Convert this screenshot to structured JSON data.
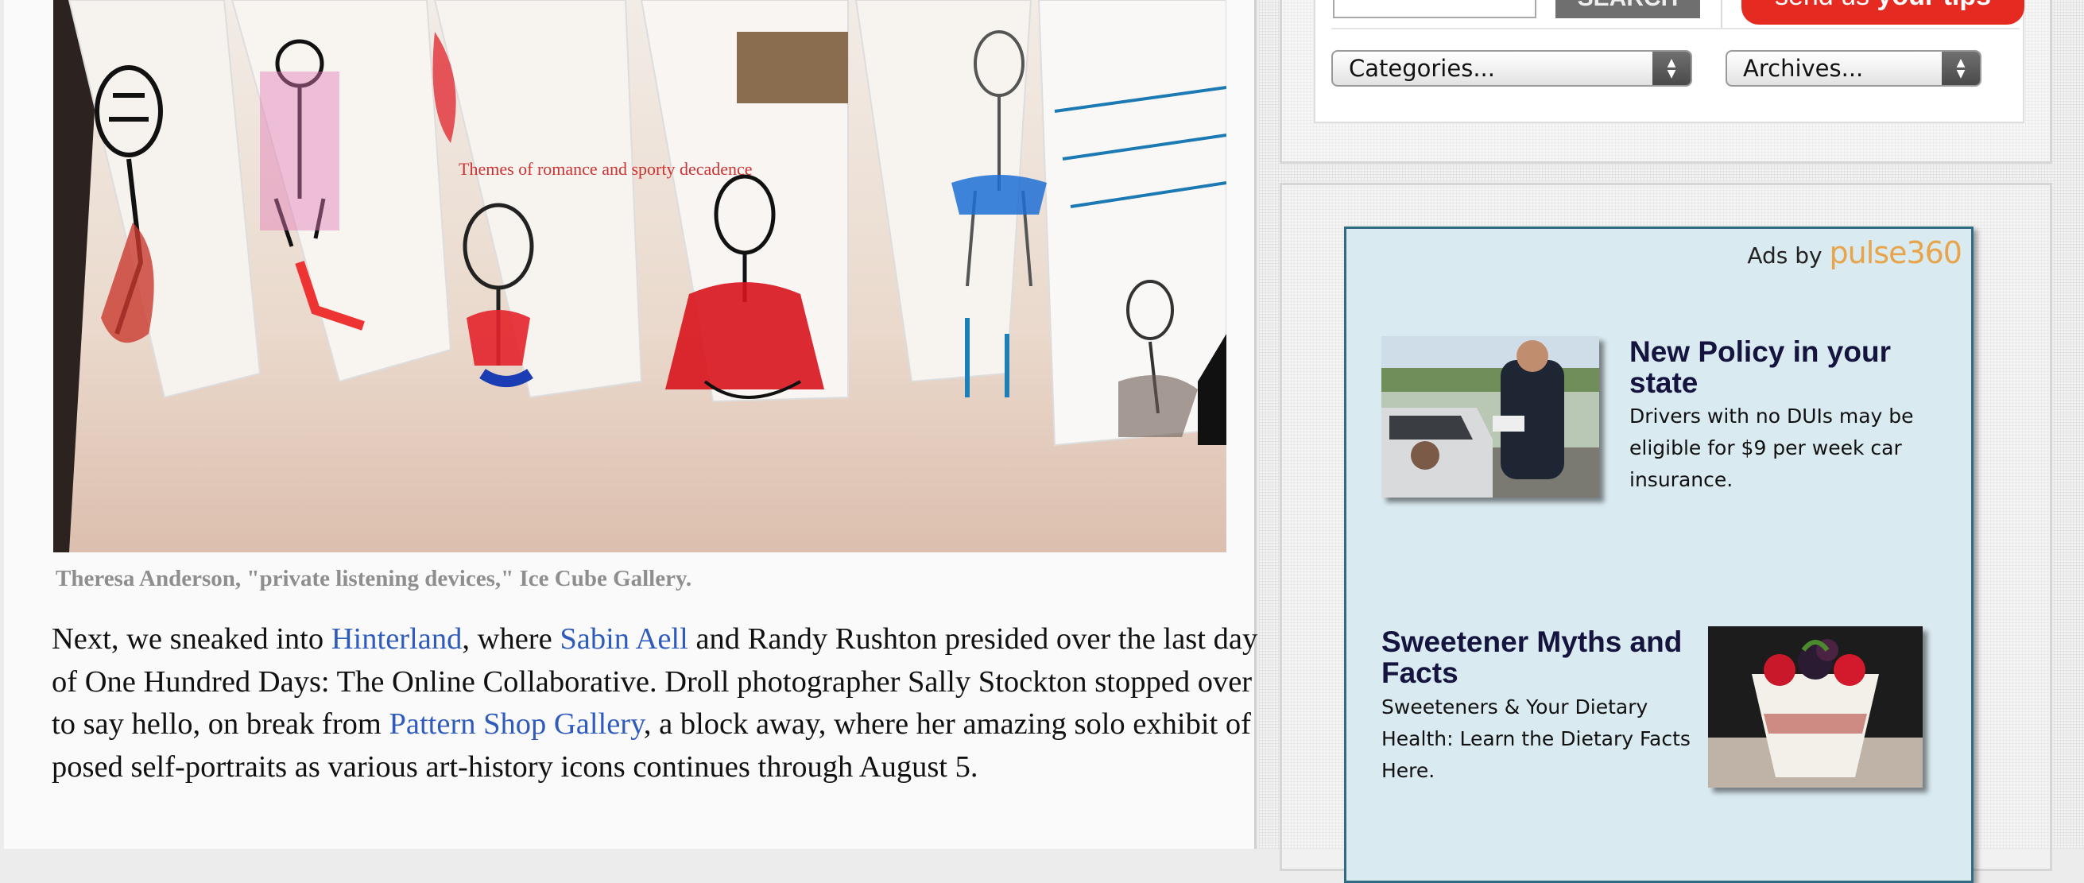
{
  "article": {
    "caption": "Theresa Anderson, \"private listening devices,\" Ice Cube Gallery.",
    "paragraph": {
      "t1": "Next, we sneaked into ",
      "link1": "Hinterland",
      "t2": ", where ",
      "link2": "Sabin Aell",
      "t3": " and Randy Rushton presided over the last day of One Hundred Days: The Online Collaborative. Droll photographer Sally Stockton stopped over to say hello, on break from ",
      "link3": "Pattern Shop Gallery",
      "t4": ", a block away, where her amazing solo exhibit of posed self-portraits as various art-history icons continues through August 5."
    },
    "photo_text": "Themes of romance and sporty decadence"
  },
  "sidebar": {
    "search_button": "SEARCH",
    "send_tips": {
      "normal": "send us ",
      "bold": "your tips"
    },
    "categories_select": "Categories...",
    "archives_select": "Archives...",
    "ads": {
      "ads_by": "Ads by ",
      "brand": "pulse360",
      "items": [
        {
          "title": "New Policy in your state",
          "description": "Drivers with no DUIs may be eligible for $9 per week car insurance.",
          "image": "police-traffic-stop-photo"
        },
        {
          "title": "Sweetener Myths and Facts",
          "description": "Sweeteners & Your Dietary Health: Learn the Dietary Facts Here.",
          "image": "berry-parfait-photo"
        }
      ]
    }
  },
  "colors": {
    "link": "#2f5cbc",
    "caption": "#8e8e8e",
    "ad_title": "#14143f",
    "ad_box_bg": "#d9eaf0",
    "ad_box_border": "#2f6b83",
    "tips_red": "#e42a21",
    "brand_orange": "#e8a44a"
  }
}
